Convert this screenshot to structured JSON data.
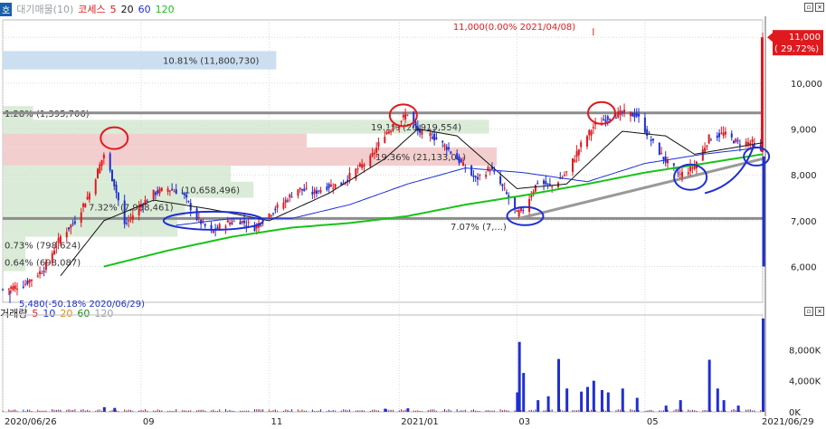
{
  "legend_price": {
    "tab_label": "호",
    "items": [
      {
        "text": "대기매물(10)",
        "color": "#9aa0a6"
      },
      {
        "text": "코세스",
        "color": "#e0191f"
      },
      {
        "text": "5",
        "color": "#e0191f"
      },
      {
        "text": "20",
        "color": "#111111"
      },
      {
        "text": "60",
        "color": "#1f2fd1"
      },
      {
        "text": "120",
        "color": "#19c219"
      }
    ]
  },
  "legend_volume": {
    "items": [
      {
        "text": "거래량",
        "color": "#111111"
      },
      {
        "text": "5",
        "color": "#e0191f"
      },
      {
        "text": "10",
        "color": "#1f2fd1"
      },
      {
        "text": "20",
        "color": "#e88a12"
      },
      {
        "text": "60",
        "color": "#1a8a1a"
      },
      {
        "text": "120",
        "color": "#9aa0a6"
      }
    ]
  },
  "colors": {
    "up": "#e0191f",
    "down": "#1f2fd1",
    "ma5": "#9a1b1b",
    "ma20": "#111111",
    "ma60": "#1f2fd1",
    "ma120": "#19c219",
    "markup_red": "#e0191f",
    "markup_blue": "#1f2fd1",
    "level_line": "#8c8c8c"
  },
  "chart_data": [
    {
      "type": "candlestick",
      "title": "코세스",
      "x_start": "2020/06/26",
      "x_end": "2021/06/29",
      "x_ticks": [
        "2020/06/26",
        "09",
        "11",
        "2021/01",
        "03",
        "05",
        "2021/06/29"
      ],
      "y_ticks": [
        "11,000",
        "10,000",
        "9,000",
        "8,000",
        "7,000",
        "6,000"
      ],
      "ylim": [
        5300,
        11300
      ],
      "current_price": {
        "label": "11,000",
        "change": "( 29.72%)"
      },
      "high_annotation": "11,000(0.00% 2021/04/08)",
      "low_annotation": "5,480(-50.18% 2020/06/29)",
      "volume_profile": [
        {
          "label": "10.81% (11,800,730)",
          "low": 10300,
          "high": 10700,
          "ratio": 0.36,
          "color": "#c5dcef"
        },
        {
          "label": "1.28% (1,395,706)",
          "low": 9200,
          "high": 9500,
          "ratio": 0.04,
          "color": "#d6ead3"
        },
        {
          "label": "19.1% (20,919,554)",
          "low": 8900,
          "high": 9200,
          "ratio": 0.64,
          "color": "#d6ead3"
        },
        {
          "label": "",
          "low": 8600,
          "high": 8900,
          "ratio": 0.4,
          "color": "#f2c9c9"
        },
        {
          "label": "19.36% (21,133,0..)",
          "low": 8200,
          "high": 8600,
          "ratio": 0.65,
          "color": "#f2c9c9"
        },
        {
          "label": "",
          "low": 7850,
          "high": 8200,
          "ratio": 0.3,
          "color": "#d6ead3"
        },
        {
          "label": "(10,658,496)",
          "low": 7500,
          "high": 7850,
          "ratio": 0.33,
          "color": "#d6ead3"
        },
        {
          "label": "7.32% (7,988,461)",
          "low": 7100,
          "high": 7500,
          "ratio": 0.24,
          "color": "#d6ead3"
        },
        {
          "label": "7.07% (7,...)",
          "low": 6650,
          "high": 7100,
          "ratio": 0.23,
          "color": "#d6ead3"
        },
        {
          "label": "0.73% (798,624)",
          "low": 6300,
          "high": 6650,
          "ratio": 0.03,
          "color": "#d6ead3"
        },
        {
          "label": "0.64% (698,087)",
          "low": 5900,
          "high": 6300,
          "ratio": 0.03,
          "color": "#d6ead3"
        }
      ],
      "levels": [
        9350,
        7050
      ],
      "trendline": {
        "from": [
          "2021/03/03",
          7050
        ],
        "to": [
          "2021/06/29",
          8350
        ]
      },
      "series": [
        {
          "name": "price",
          "waypoints": [
            [
              "2020/06/26",
              5500
            ],
            [
              "2020/07/06",
              5600
            ],
            [
              "2020/07/16",
              5950
            ],
            [
              "2020/07/24",
              6650
            ],
            [
              "2020/07/31",
              7000
            ],
            [
              "2020/08/07",
              7600
            ],
            [
              "2020/08/14",
              8450
            ],
            [
              "2020/08/19",
              7800
            ],
            [
              "2020/08/24",
              6900
            ],
            [
              "2020/08/31",
              7300
            ],
            [
              "2020/09/07",
              7600
            ],
            [
              "2020/09/14",
              7700
            ],
            [
              "2020/09/21",
              7600
            ],
            [
              "2020/09/28",
              7050
            ],
            [
              "2020/10/05",
              6750
            ],
            [
              "2020/10/12",
              6950
            ],
            [
              "2020/10/19",
              7000
            ],
            [
              "2020/10/26",
              6850
            ],
            [
              "2020/11/02",
              7150
            ],
            [
              "2020/11/09",
              7400
            ],
            [
              "2020/11/16",
              7700
            ],
            [
              "2020/11/23",
              7600
            ],
            [
              "2020/11/30",
              7750
            ],
            [
              "2020/12/07",
              7800
            ],
            [
              "2020/12/14",
              8100
            ],
            [
              "2020/12/21",
              8350
            ],
            [
              "2020/12/28",
              8900
            ],
            [
              "2021/01/04",
              9150
            ],
            [
              "2021/01/08",
              9350
            ],
            [
              "2021/01/13",
              8950
            ],
            [
              "2021/01/20",
              8850
            ],
            [
              "2021/01/27",
              8600
            ],
            [
              "2021/02/03",
              8250
            ],
            [
              "2021/02/10",
              7900
            ],
            [
              "2021/02/17",
              8150
            ],
            [
              "2021/02/24",
              7650
            ],
            [
              "2021/03/02",
              7150
            ],
            [
              "2021/03/05",
              7250
            ],
            [
              "2021/03/12",
              7850
            ],
            [
              "2021/03/19",
              7750
            ],
            [
              "2021/03/26",
              8050
            ],
            [
              "2021/04/02",
              8650
            ],
            [
              "2021/04/08",
              9050
            ],
            [
              "2021/04/15",
              9250
            ],
            [
              "2021/04/22",
              9350
            ],
            [
              "2021/04/29",
              9300
            ],
            [
              "2021/05/06",
              8750
            ],
            [
              "2021/05/13",
              8300
            ],
            [
              "2021/05/20",
              8000
            ],
            [
              "2021/05/27",
              8200
            ],
            [
              "2021/06/03",
              8800
            ],
            [
              "2021/06/10",
              8900
            ],
            [
              "2021/06/17",
              8700
            ],
            [
              "2021/06/24",
              8700
            ],
            [
              "2021/06/28",
              8500
            ],
            [
              "2021/06/29",
              11000
            ]
          ]
        },
        {
          "name": "20",
          "waypoints": [
            [
              "2020/07/24",
              5800
            ],
            [
              "2020/08/14",
              7000
            ],
            [
              "2020/09/07",
              7450
            ],
            [
              "2020/10/05",
              7250
            ],
            [
              "2020/11/02",
              7000
            ],
            [
              "2020/12/01",
              7600
            ],
            [
              "2020/12/28",
              8350
            ],
            [
              "2021/01/13",
              9000
            ],
            [
              "2021/02/01",
              8850
            ],
            [
              "2021/03/02",
              7700
            ],
            [
              "2021/03/26",
              7800
            ],
            [
              "2021/04/22",
              8950
            ],
            [
              "2021/05/13",
              8850
            ],
            [
              "2021/05/27",
              8450
            ],
            [
              "2021/06/29",
              8700
            ]
          ]
        },
        {
          "name": "60",
          "waypoints": [
            [
              "2020/09/18",
              6900
            ],
            [
              "2020/10/15",
              7050
            ],
            [
              "2020/11/13",
              7050
            ],
            [
              "2020/12/11",
              7350
            ],
            [
              "2021/01/08",
              7800
            ],
            [
              "2021/02/05",
              8150
            ],
            [
              "2021/03/05",
              8050
            ],
            [
              "2021/04/05",
              7850
            ],
            [
              "2021/05/03",
              8250
            ],
            [
              "2021/05/31",
              8450
            ],
            [
              "2021/06/29",
              8600
            ]
          ]
        },
        {
          "name": "120",
          "waypoints": [
            [
              "2020/08/14",
              6000
            ],
            [
              "2020/09/14",
              6350
            ],
            [
              "2020/10/15",
              6650
            ],
            [
              "2020/11/13",
              6850
            ],
            [
              "2020/12/11",
              6950
            ],
            [
              "2021/01/08",
              7100
            ],
            [
              "2021/02/05",
              7350
            ],
            [
              "2021/03/05",
              7550
            ],
            [
              "2021/04/05",
              7800
            ],
            [
              "2021/05/03",
              8050
            ],
            [
              "2021/06/01",
              8250
            ],
            [
              "2021/06/29",
              8450
            ]
          ]
        }
      ]
    },
    {
      "type": "bar",
      "title": "거래량",
      "y_ticks": [
        "8,000K",
        "4,000K",
        "0K"
      ],
      "ylim": [
        0,
        12000
      ],
      "base_volume_k": 250,
      "spikes": [
        [
          "2020/08/14",
          600
        ],
        [
          "2020/08/19",
          500
        ],
        [
          "2020/12/28",
          400
        ],
        [
          "2021/01/08",
          450
        ],
        [
          "2021/03/02",
          2500
        ],
        [
          "2021/03/03",
          9000
        ],
        [
          "2021/03/05",
          5000
        ],
        [
          "2021/03/12",
          1500
        ],
        [
          "2021/03/17",
          2000
        ],
        [
          "2021/03/22",
          6800
        ],
        [
          "2021/03/26",
          3000
        ],
        [
          "2021/04/02",
          2600
        ],
        [
          "2021/04/05",
          3200
        ],
        [
          "2021/04/08",
          4000
        ],
        [
          "2021/04/12",
          2800
        ],
        [
          "2021/04/15",
          2500
        ],
        [
          "2021/04/22",
          3000
        ],
        [
          "2021/04/29",
          1800
        ],
        [
          "2021/05/13",
          800
        ],
        [
          "2021/05/20",
          1500
        ],
        [
          "2021/06/03",
          6700
        ],
        [
          "2021/06/07",
          3000
        ],
        [
          "2021/06/10",
          1500
        ],
        [
          "2021/06/17",
          800
        ],
        [
          "2021/06/29",
          12000
        ]
      ]
    }
  ]
}
